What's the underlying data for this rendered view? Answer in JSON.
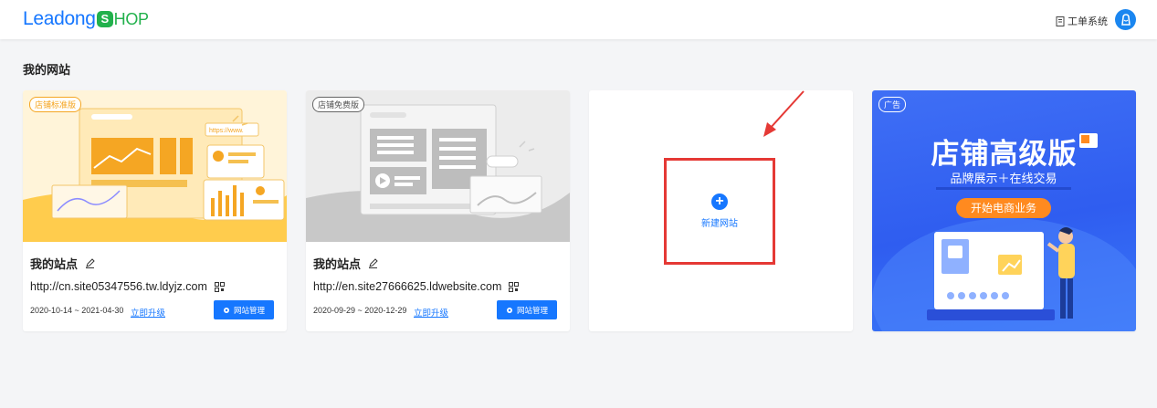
{
  "header": {
    "logo_text": "Leadong",
    "logo_s": "S",
    "logo_suffix": "HOP",
    "ticket_label": "工单系统"
  },
  "page": {
    "section_title": "我的网站"
  },
  "sites": [
    {
      "tag": "店铺标准版",
      "name": "我的站点",
      "url": "http://cn.site05347556.tw.ldyjz.com",
      "dates": "2020-10-14 ~ 2021-04-30",
      "upgrade_label": "立即升级",
      "manage_label": "网站管理",
      "art_url_text": "https://www."
    },
    {
      "tag": "店铺免费版",
      "name": "我的站点",
      "url": "http://en.site27666625.ldwebsite.com",
      "dates": "2020-09-29 ~ 2020-12-29",
      "upgrade_label": "立即升级",
      "manage_label": "网站管理"
    }
  ],
  "new_site": {
    "label": "新建网站"
  },
  "ad": {
    "tag": "广告",
    "title": "店铺高级版",
    "subtitle": "品牌展示＋在线交易",
    "button_label": "开始电商业务"
  },
  "colors": {
    "primary": "#1677ff",
    "brand_green": "#22b14c",
    "highlight_red": "#e53935",
    "ad_orange": "#ff8a1f",
    "standard_tag": "#f5a623"
  },
  "icons": [
    "ticket-icon",
    "avatar-icon",
    "edit-icon",
    "qrcode-icon",
    "gear-icon",
    "plus-icon",
    "arrow-annotation"
  ]
}
